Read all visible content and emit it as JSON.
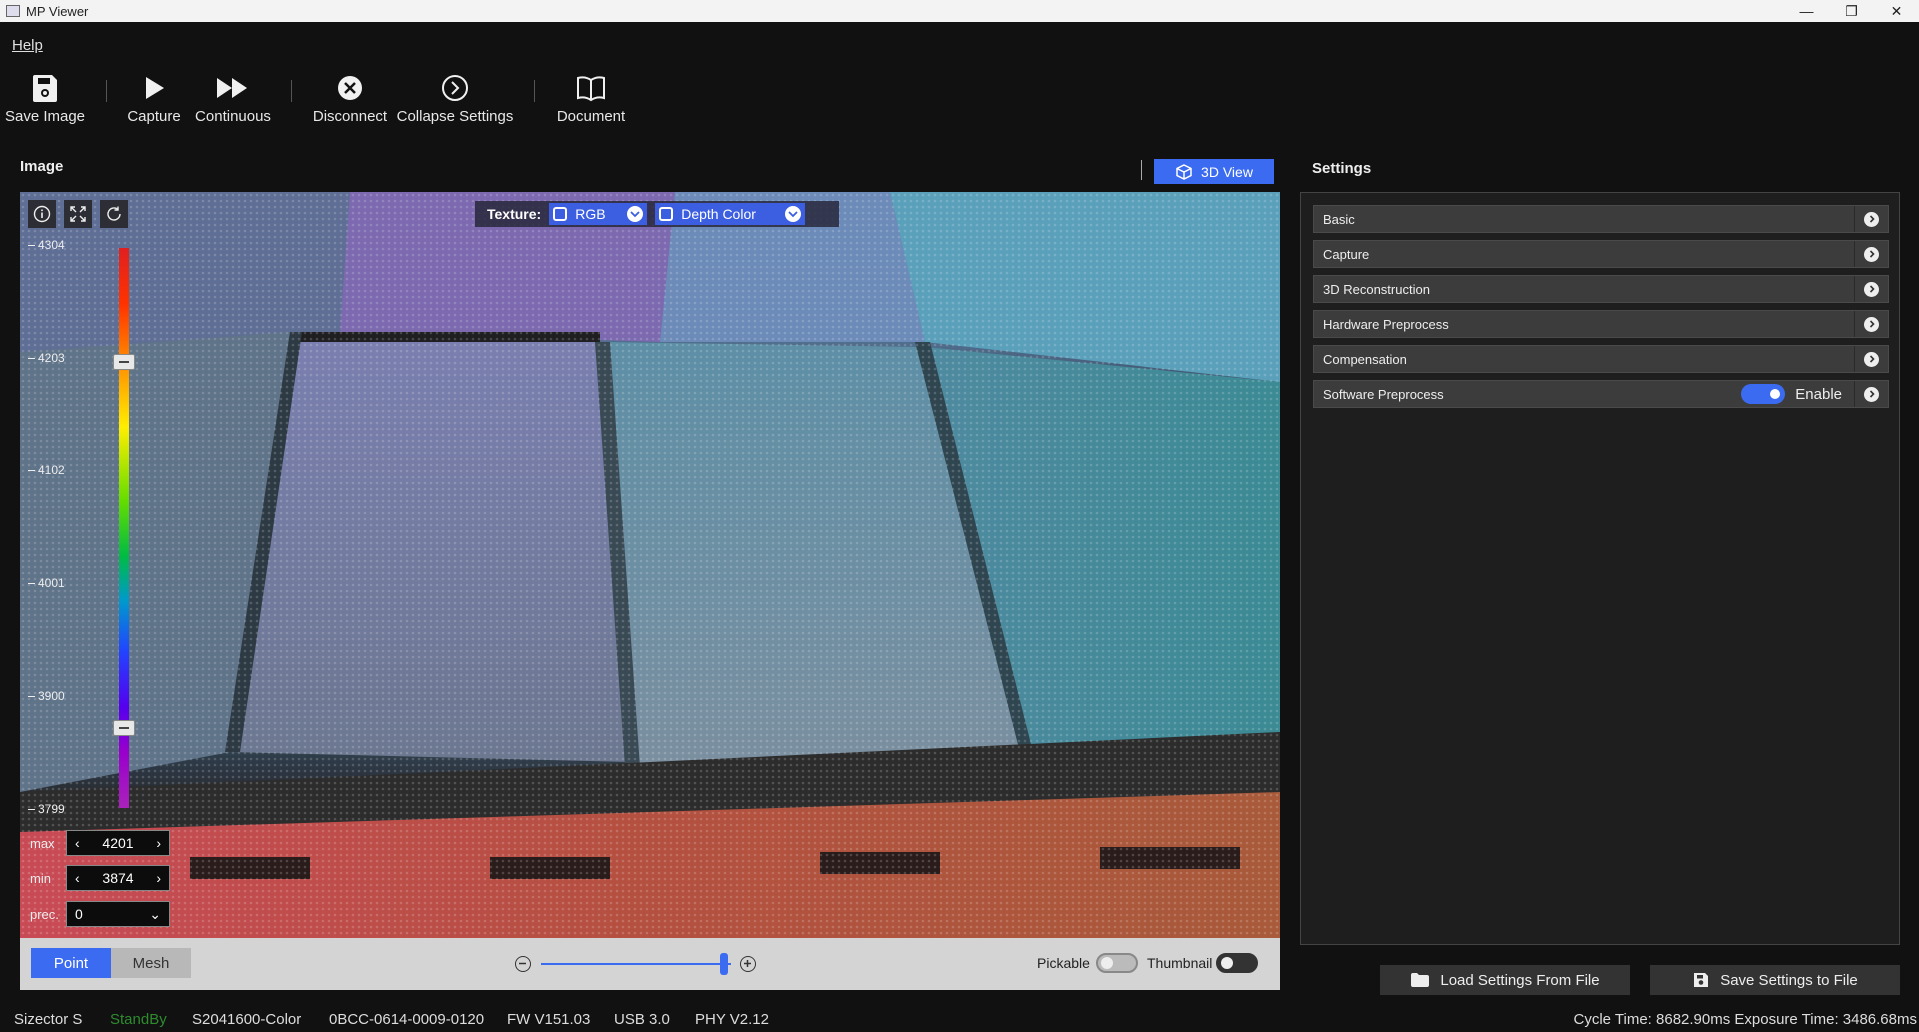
{
  "window": {
    "title": "MP Viewer",
    "controls": [
      "—",
      "❐",
      "✕"
    ]
  },
  "menu": {
    "help": "Help"
  },
  "toolbar": {
    "save_image": "Save Image",
    "capture": "Capture",
    "continuous": "Continuous",
    "disconnect": "Disconnect",
    "collapse_settings": "Collapse Settings",
    "document": "Document"
  },
  "image_panel": {
    "title": "Image",
    "view_mode": "3D View",
    "texture": {
      "label": "Texture:",
      "option1": "RGB",
      "option2": "Depth Color"
    },
    "scale_ticks": [
      "4304",
      "4203",
      "4102",
      "4001",
      "3900",
      "3799"
    ],
    "max_label": "max",
    "max_value": "4201",
    "min_label": "min",
    "min_value": "3874",
    "prec_label": "prec.",
    "prec_value": "0",
    "render_modes": {
      "point": "Point",
      "mesh": "Mesh"
    },
    "pickable": "Pickable",
    "thumbnail": "Thumbnail"
  },
  "settings": {
    "title": "Settings",
    "sections": [
      "Basic",
      "Capture",
      "3D Reconstruction",
      "Hardware Preprocess",
      "Compensation",
      "Software Preprocess"
    ],
    "software_preprocess_enable": "Enable",
    "load_button": "Load Settings From File",
    "save_button": "Save Settings to File"
  },
  "statusbar": {
    "device": "Sizector S",
    "state": "StandBy",
    "model": "S2041600-Color",
    "serial": "0BCC-0614-0009-0120",
    "fw": "FW V151.03",
    "usb": "USB 3.0",
    "phy": "PHY V2.12",
    "timing": "Cycle Time: 8682.90ms Exposure Time: 3486.68ms"
  },
  "colors": {
    "accent": "#3b6bf0",
    "standby": "#2e8b2e",
    "background": "#111111"
  }
}
